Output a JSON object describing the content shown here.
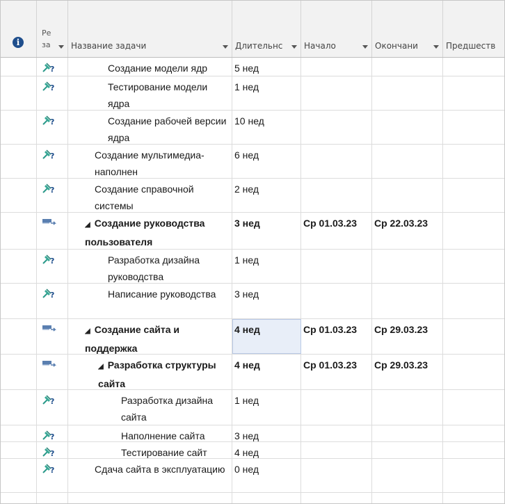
{
  "header": {
    "mode_line1": "Ре",
    "mode_line2": "за",
    "task_name": "Название задачи",
    "duration": "Длительнс",
    "start": "Начало",
    "finish": "Окончани",
    "predecessors": "Предшеств"
  },
  "icons": {
    "info": "info-icon",
    "auto": "pushpin-question-icon",
    "manual": "auto-schedule-arrow-icon"
  },
  "colors": {
    "accent": "#1f4e8c",
    "selected_cell": "#e8eef8"
  },
  "rows": [
    {
      "name": "Создание модели ядр",
      "duration": "5 нед",
      "start": "",
      "finish": "",
      "icon": "auto",
      "indent": 2,
      "summary": false
    },
    {
      "name": "Тестирование модели ядра",
      "duration": "1 нед",
      "start": "",
      "finish": "",
      "icon": "auto",
      "indent": 2,
      "summary": false
    },
    {
      "name": "Создание рабочей версии ядра",
      "duration": "10 нед",
      "start": "",
      "finish": "",
      "icon": "auto",
      "indent": 2,
      "summary": false
    },
    {
      "name": "Создание мультимедиа-наполнен",
      "duration": "6 нед",
      "start": "",
      "finish": "",
      "icon": "auto",
      "indent": 1,
      "summary": false
    },
    {
      "name": "Создание справочной системы",
      "duration": "2 нед",
      "start": "",
      "finish": "",
      "icon": "auto",
      "indent": 1,
      "summary": false
    },
    {
      "name": "Создание руководства пользователя",
      "duration": "3 нед",
      "start": "Ср 01.03.23",
      "finish": "Ср 22.03.23",
      "icon": "manual",
      "indent": 1,
      "summary": true
    },
    {
      "name": "Разработка дизайна руководства",
      "duration": "1 нед",
      "start": "",
      "finish": "",
      "icon": "auto",
      "indent": 2,
      "summary": false
    },
    {
      "name": "Написание руководства",
      "duration": "3 нед",
      "start": "",
      "finish": "",
      "icon": "auto",
      "indent": 2,
      "summary": false
    },
    {
      "name": "Создание сайта и поддержка",
      "duration": "4 нед",
      "start": "Ср 01.03.23",
      "finish": "Ср 29.03.23",
      "icon": "manual",
      "indent": 1,
      "summary": true
    },
    {
      "name": "Разработка структуры сайта",
      "duration": "4 нед",
      "start": "Ср 01.03.23",
      "finish": "Ср 29.03.23",
      "icon": "manual",
      "indent": 2,
      "summary": true
    },
    {
      "name": "Разработка дизайна сайта",
      "duration": "1 нед",
      "start": "",
      "finish": "",
      "icon": "auto",
      "indent": 3,
      "summary": false
    },
    {
      "name": "Наполнение сайта",
      "duration": "3 нед",
      "start": "",
      "finish": "",
      "icon": "auto",
      "indent": 3,
      "summary": false
    },
    {
      "name": "Тестирование сайт",
      "duration": "4 нед",
      "start": "",
      "finish": "",
      "icon": "auto",
      "indent": 3,
      "summary": false
    },
    {
      "name": "Сдача сайта в эксплуатацию",
      "duration": "0 нед",
      "start": "",
      "finish": "",
      "icon": "auto",
      "indent": 1,
      "summary": false
    }
  ]
}
